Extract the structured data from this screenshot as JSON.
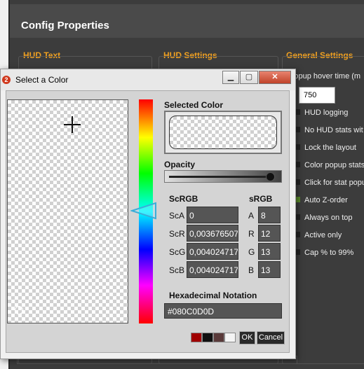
{
  "config": {
    "title": "Config Properties",
    "groups": {
      "hud_text": "HUD Text",
      "hud_settings": "HUD Settings",
      "general_settings": "General Settings"
    },
    "popup_hover_label": "Popup hover time (m",
    "popup_hover_value": "750",
    "settings": [
      {
        "label": "HUD logging",
        "checked": false
      },
      {
        "label": "No HUD stats wit",
        "checked": false
      },
      {
        "label": "Lock the layout",
        "checked": false
      },
      {
        "label": "Color popup stats",
        "checked": false
      },
      {
        "label": "Click for stat popu",
        "checked": false
      },
      {
        "label": "Auto Z-order",
        "checked": true
      },
      {
        "label": "Always on top",
        "checked": false
      },
      {
        "label": "Active only",
        "checked": false
      },
      {
        "label": "Cap % to 99%",
        "checked": false
      }
    ]
  },
  "dialog": {
    "title": "Select a Color",
    "app_icon_text": "2",
    "window_buttons": {
      "minimize": "▁",
      "maximize": "▢",
      "close": "✕"
    },
    "selected_color_label": "Selected Color",
    "opacity_label": "Opacity",
    "opacity_value": 0.94,
    "scrgb_label": "ScRGB",
    "srgb_label": "sRGB",
    "scrgb": [
      {
        "label": "ScA",
        "value": "0"
      },
      {
        "label": "ScR",
        "value": "0,003676507"
      },
      {
        "label": "ScG",
        "value": "0,004024717"
      },
      {
        "label": "ScB",
        "value": "0,004024717"
      }
    ],
    "srgb": [
      {
        "label": "A",
        "value": "8"
      },
      {
        "label": "R",
        "value": "12"
      },
      {
        "label": "G",
        "value": "13"
      },
      {
        "label": "B",
        "value": "13"
      }
    ],
    "hex_label": "Hexadecimal Notation",
    "hex_value": "#080C0D0D",
    "recent_colors": [
      "#a00000",
      "#101010",
      "#5a3a3a",
      "#f4f4f4"
    ],
    "ok_label": "OK",
    "cancel_label": "Cancel"
  }
}
